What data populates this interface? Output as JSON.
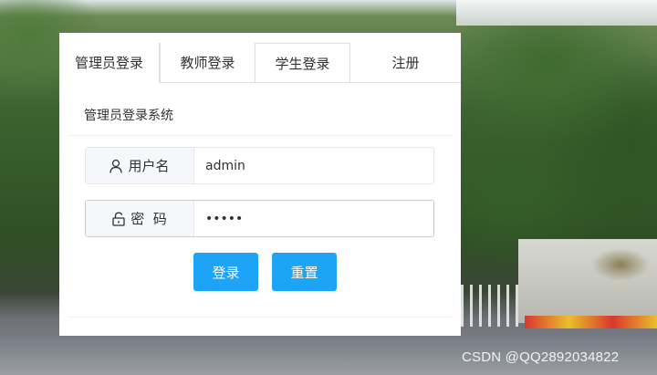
{
  "tabs": [
    {
      "label": "管理员登录",
      "active": true
    },
    {
      "label": "教师登录",
      "active": false
    },
    {
      "label": "学生登录",
      "active": false
    },
    {
      "label": "注册",
      "active": false
    }
  ],
  "panel": {
    "title": "管理员登录系统",
    "username": {
      "label": "用户名",
      "icon": "user-icon",
      "value": "admin"
    },
    "password": {
      "label": "密  码",
      "icon": "unlock-icon",
      "value": "admin"
    },
    "buttons": {
      "login": "登录",
      "reset": "重置"
    }
  },
  "watermark": "CSDN @QQ2892034822",
  "colors": {
    "primary": "#1ea4f7",
    "label_bg": "#f5f7fa",
    "border": "#dcdfe6"
  }
}
